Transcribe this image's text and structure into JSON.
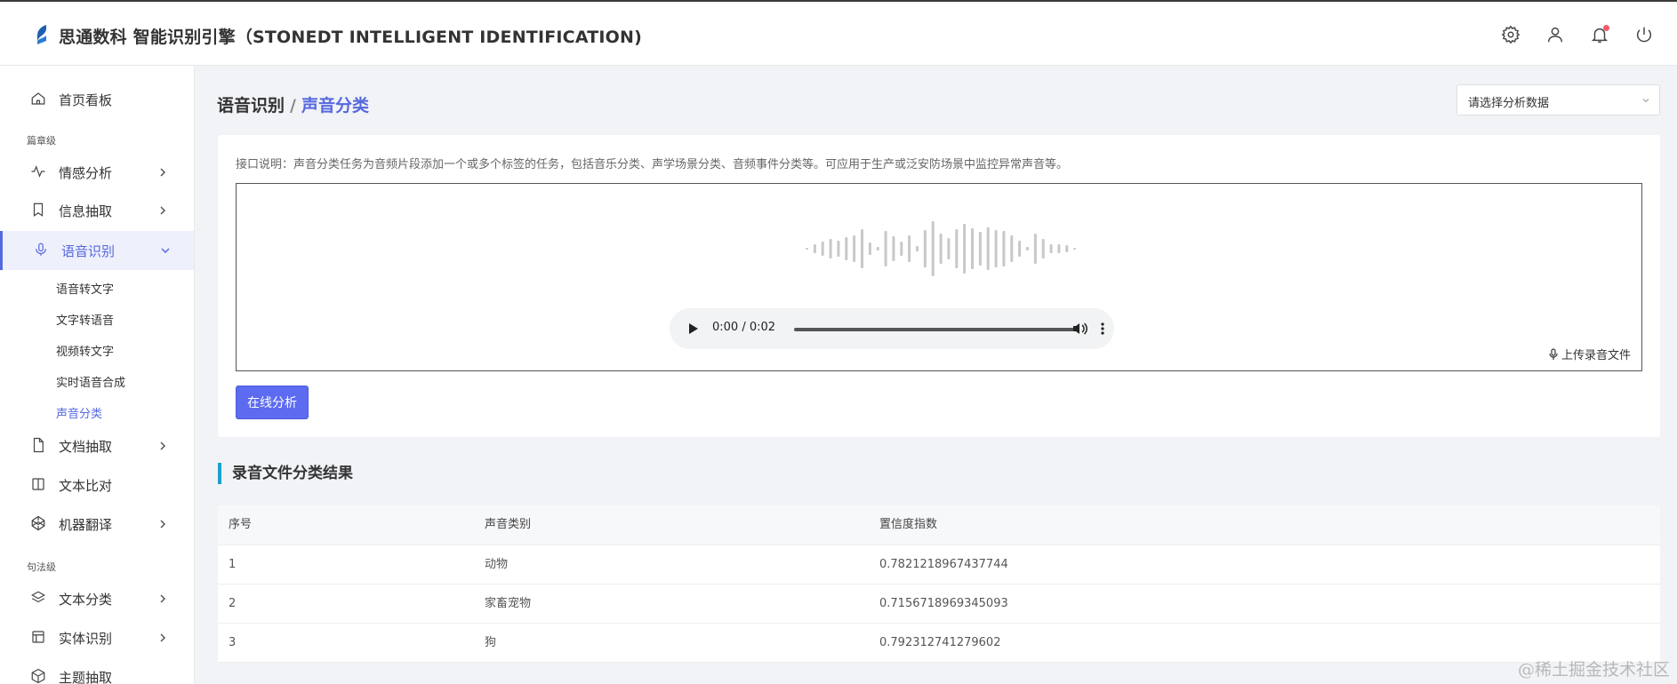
{
  "app": {
    "title": "思通数科 智能识别引擎（STONEDT INTELLIGENT IDENTIFICATION)"
  },
  "sidebar": {
    "dashboard": "首页看板",
    "section_chapter": "篇章级",
    "sentiment": "情感分析",
    "extraction": "信息抽取",
    "speech": "语音识别",
    "speech_sub": [
      "语音转文字",
      "文字转语音",
      "视频转文字",
      "实时语音合成",
      "声音分类"
    ],
    "doc_extract": "文档抽取",
    "text_compare": "文本比对",
    "translate": "机器翻译",
    "section_sentence": "句法级",
    "text_classify": "文本分类",
    "entity": "实体识别",
    "topic": "主题抽取"
  },
  "breadcrumb": {
    "parent": "语音识别",
    "separator": "/",
    "current": "声音分类"
  },
  "select": {
    "placeholder": "请选择分析数据"
  },
  "main": {
    "description": "接口说明：声音分类任务为音频片段添加一个或多个标签的任务，包括音乐分类、声学场景分类、音频事件分类等。可应用于生产或泛安防场景中监控异常声音等。",
    "player_time": "0:00 / 0:02",
    "player_progress": 0,
    "upload_label": "上传录音文件",
    "analyze_button": "在线分析"
  },
  "results": {
    "title": "录音文件分类结果",
    "columns": [
      "序号",
      "声音类别",
      "置信度指数"
    ],
    "rows": [
      [
        "1",
        "动物",
        "0.7821218967437744"
      ],
      [
        "2",
        "家畜宠物",
        "0.7156718969345093"
      ],
      [
        "3",
        "狗",
        "0.792312741279602"
      ]
    ]
  },
  "watermark": "@稀土掘金技术社区",
  "colors": {
    "accent": "#5568e0",
    "button": "#5c6bf0",
    "result_bar": "#1da1c9"
  }
}
